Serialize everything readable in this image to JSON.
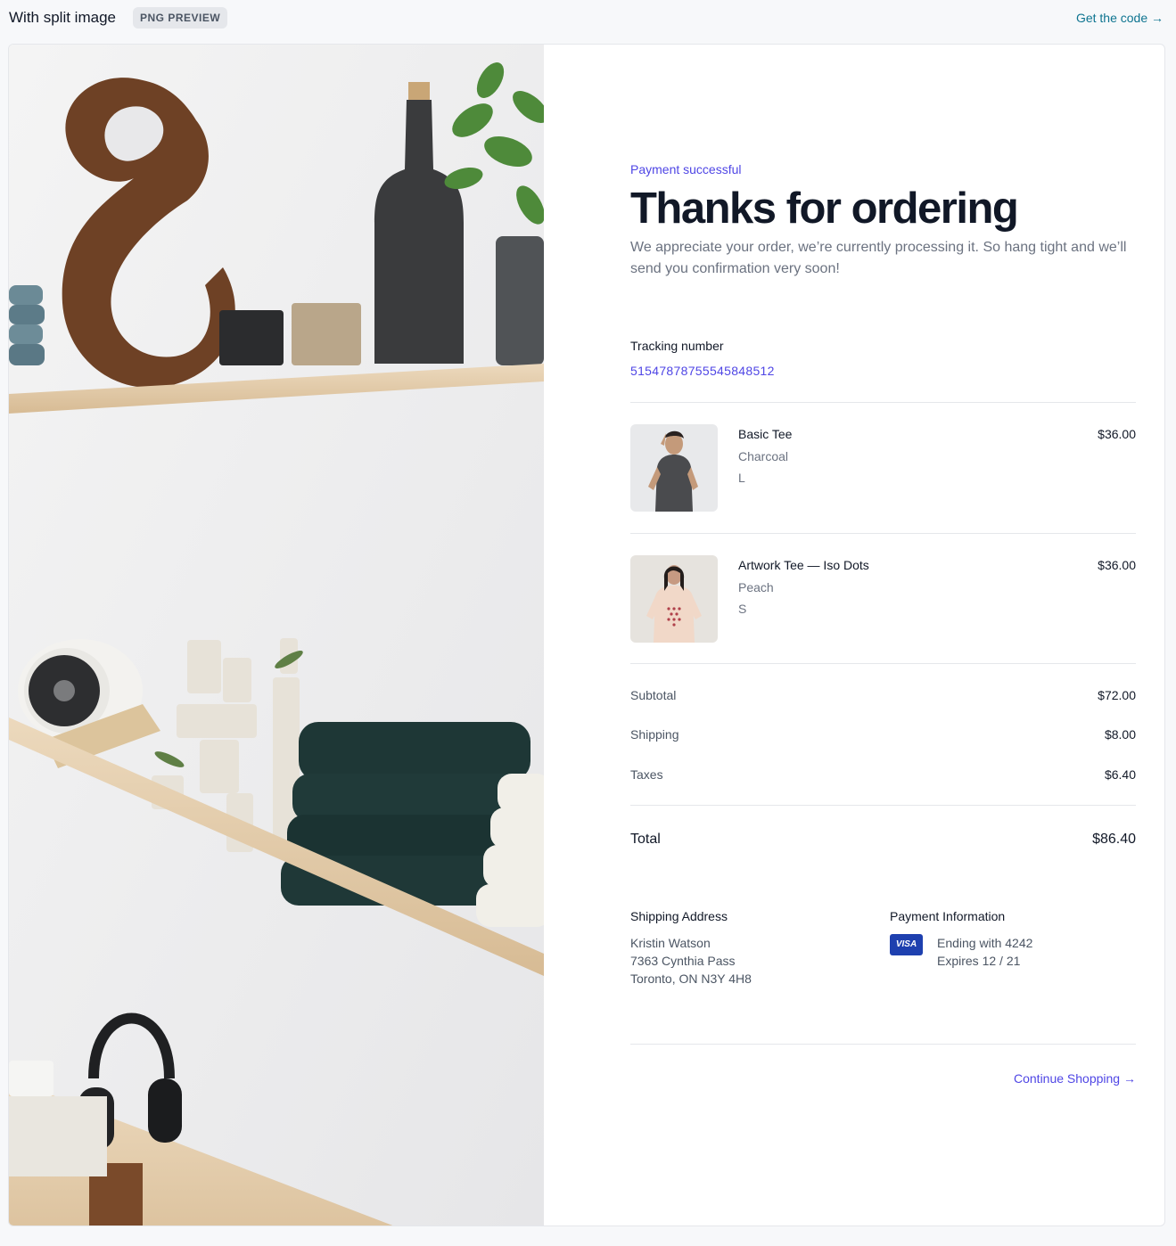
{
  "preview": {
    "title": "With split image",
    "badge": "PNG PREVIEW",
    "code_link": "Get the code →"
  },
  "hero": {
    "eyebrow": "Payment successful",
    "headline": "Thanks for ordering",
    "lead": "We appreciate your order, we’re currently processing it. So hang tight and we’ll send you confirmation very soon!"
  },
  "tracking": {
    "label": "Tracking number",
    "number": "51547878755545848512"
  },
  "items": [
    {
      "name": "Basic Tee",
      "color": "Charcoal",
      "size": "L",
      "price": "$36.00"
    },
    {
      "name": "Artwork Tee — Iso Dots",
      "color": "Peach",
      "size": "S",
      "price": "$36.00"
    }
  ],
  "summary": {
    "subtotal_label": "Subtotal",
    "subtotal": "$72.00",
    "shipping_label": "Shipping",
    "shipping": "$8.00",
    "taxes_label": "Taxes",
    "taxes": "$6.40",
    "total_label": "Total",
    "total": "$86.40"
  },
  "shipping_address": {
    "title": "Shipping Address",
    "name": "Kristin Watson",
    "street": "7363 Cynthia Pass",
    "city": "Toronto, ON N3Y 4H8"
  },
  "payment": {
    "title": "Payment Information",
    "card_brand": "VISA",
    "ending": "Ending with 4242",
    "expires": "Expires 12 / 21"
  },
  "continue_label": "Continue Shopping →",
  "colors": {
    "accent": "#4f46e5",
    "link": "#0e7490",
    "text": "#111827",
    "muted": "#6b7280",
    "visa": "#1e40af"
  }
}
